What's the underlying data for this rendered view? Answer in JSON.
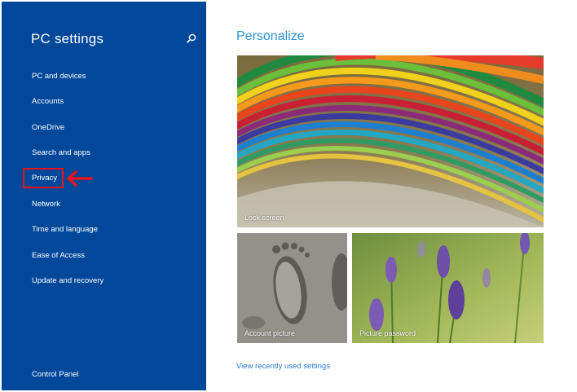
{
  "sidebar": {
    "title": "PC settings",
    "search_icon": "search-icon",
    "items": [
      {
        "label": "PC and devices"
      },
      {
        "label": "Accounts"
      },
      {
        "label": "OneDrive"
      },
      {
        "label": "Search and apps"
      },
      {
        "label": "Privacy",
        "highlighted": true
      },
      {
        "label": "Network"
      },
      {
        "label": "Time and language"
      },
      {
        "label": "Ease of Access"
      },
      {
        "label": "Update and recovery"
      }
    ],
    "footer_link": "Control Panel"
  },
  "main": {
    "title": "Personalize",
    "tiles": {
      "lock_screen": "Lock screen",
      "account_picture": "Account picture",
      "picture_password": "Picture password"
    },
    "recent_link": "View recently used settings"
  },
  "colors": {
    "sidebar_bg": "#01489a",
    "accent": "#2b94d6",
    "annotation": "#e8151c"
  }
}
